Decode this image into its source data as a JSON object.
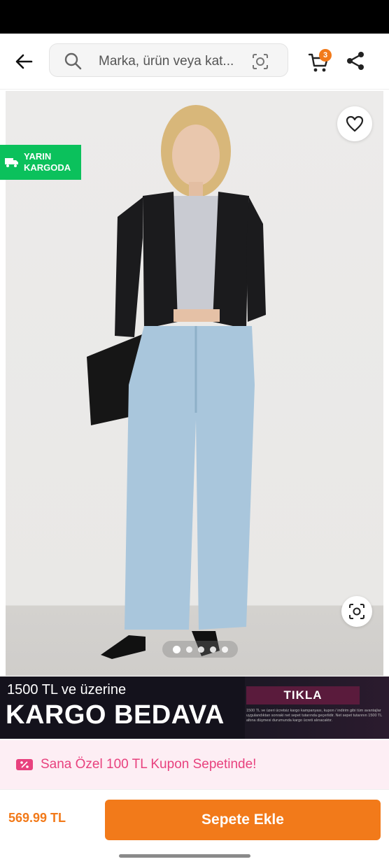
{
  "search": {
    "placeholder": "Marka, ürün veya kat..."
  },
  "cart": {
    "count": "3"
  },
  "product": {
    "delivery_badge_line1": "YARIN",
    "delivery_badge_line2": "KARGODA",
    "image_dots": 5,
    "active_dot": 0
  },
  "promo": {
    "line1": "1500 TL ve üzerine",
    "line2": "KARGO BEDAVA",
    "cta": "TIKLA",
    "fine_print": "1500 TL ve üzeri ücretsiz kargo kampanyası, kupon / indirim gibi tüm avantajlar uygulandıktan sonraki net sepet tutarında geçerlidir. Net sepet tutarının 1500 TL altına düşmesi durumunda kargo ücreti alınacaktır."
  },
  "coupon": {
    "text": "Sana Özel 100 TL Kupon Sepetinde!"
  },
  "footer": {
    "price": "569.99 TL",
    "add_to_cart": "Sepete Ekle"
  },
  "colors": {
    "brand_orange": "#f27a1a",
    "cargo_green": "#0bc15c",
    "coupon_pink": "#e8417e"
  },
  "icons": [
    "arrow-back-icon",
    "search-icon",
    "camera-search-icon",
    "cart-icon",
    "share-icon",
    "heart-icon",
    "lens-icon",
    "truck-icon",
    "coupon-icon"
  ]
}
